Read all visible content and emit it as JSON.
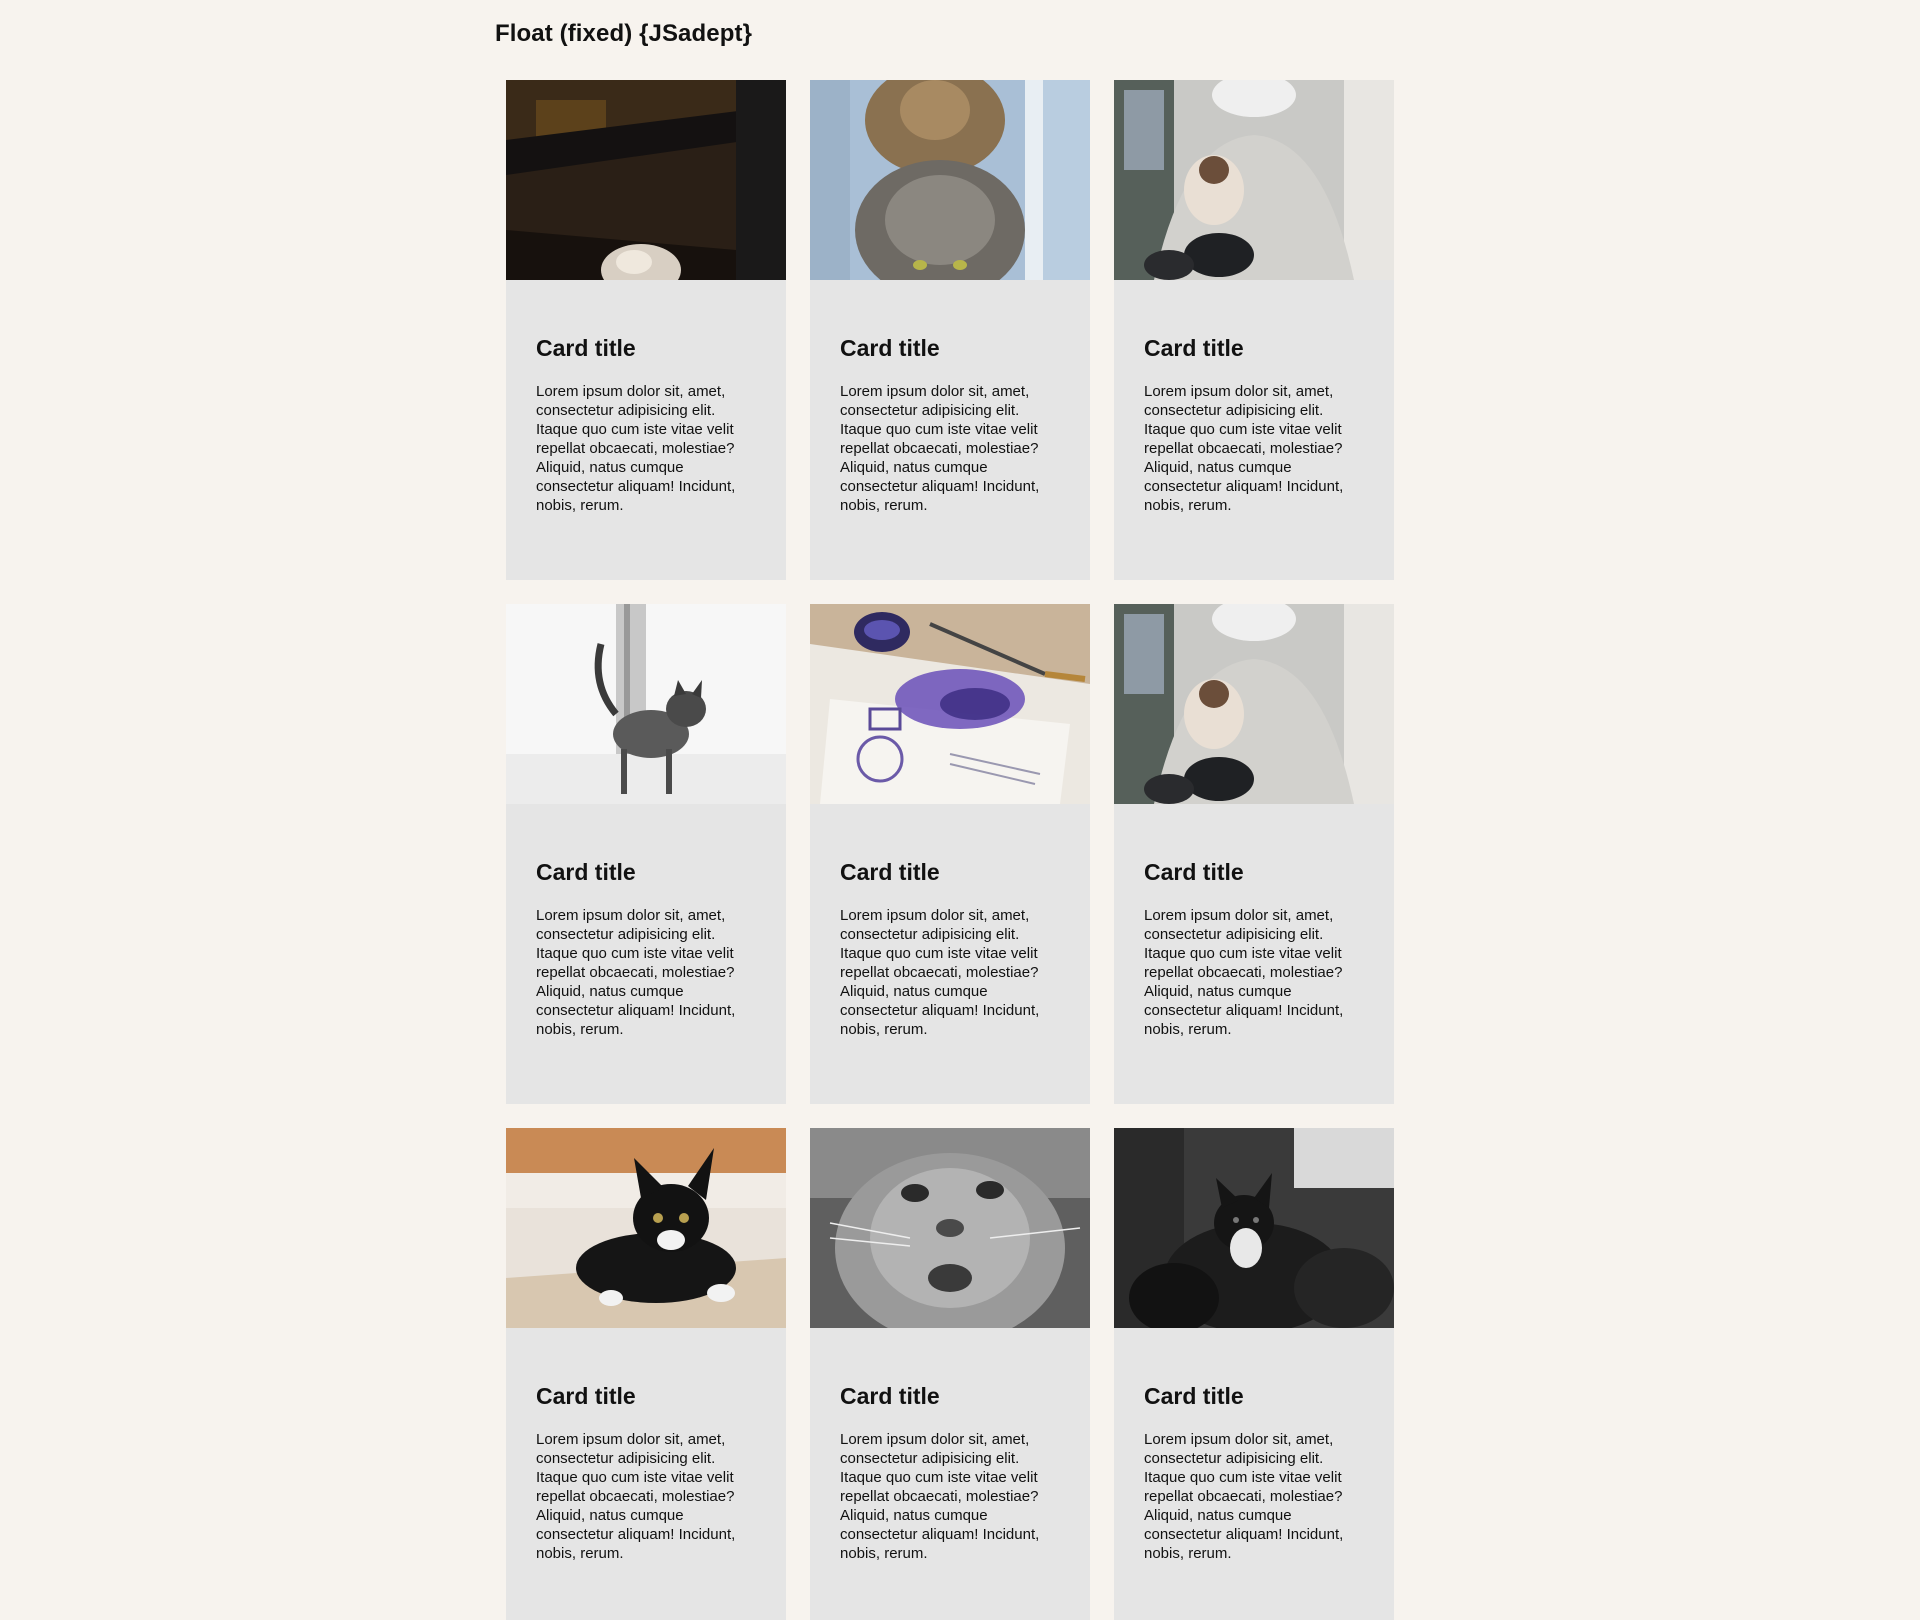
{
  "page": {
    "title": "Float (fixed) {JSadept}"
  },
  "cards": [
    {
      "title": "Card title",
      "text": "Lorem ipsum dolor sit, amet, consectetur adipisicing elit. Itaque quo cum iste vitae velit repellat obcaecati, molestiae? Aliquid, natus cumque consectetur aliquam! Incidunt, nobis, rerum.",
      "image": "cat-under-dark-chair-photo"
    },
    {
      "title": "Card title",
      "text": "Lorem ipsum dolor sit, amet, consectetur adipisicing elit. Itaque quo cum iste vitae velit repellat obcaecati, molestiae? Aliquid, natus cumque consectetur aliquam! Incidunt, nobis, rerum.",
      "image": "two-tabby-cats-photo"
    },
    {
      "title": "Card title",
      "text": "Lorem ipsum dolor sit, amet, consectetur adipisicing elit. Itaque quo cum iste vitae velit repellat obcaecati, molestiae? Aliquid, natus cumque consectetur aliquam! Incidunt, nobis, rerum.",
      "image": "rider-holding-kitten-photo"
    },
    {
      "title": "Card title",
      "text": "Lorem ipsum dolor sit, amet, consectetur adipisicing elit. Itaque quo cum iste vitae velit repellat obcaecati, molestiae? Aliquid, natus cumque consectetur aliquam! Incidunt, nobis, rerum.",
      "image": "tabby-kitten-window-photo"
    },
    {
      "title": "Card title",
      "text": "Lorem ipsum dolor sit, amet, consectetur adipisicing elit. Itaque quo cum iste vitae velit repellat obcaecati, molestiae? Aliquid, natus cumque consectetur aliquam! Incidunt, nobis, rerum.",
      "image": "ink-drawing-palette-photo"
    },
    {
      "title": "Card title",
      "text": "Lorem ipsum dolor sit, amet, consectetur adipisicing elit. Itaque quo cum iste vitae velit repellat obcaecati, molestiae? Aliquid, natus cumque consectetur aliquam! Incidunt, nobis, rerum.",
      "image": "rider-holding-kitten-photo"
    },
    {
      "title": "Card title",
      "text": "Lorem ipsum dolor sit, amet, consectetur adipisicing elit. Itaque quo cum iste vitae velit repellat obcaecati, molestiae? Aliquid, natus cumque consectetur aliquam! Incidunt, nobis, rerum.",
      "image": "black-white-kitten-photo"
    },
    {
      "title": "Card title",
      "text": "Lorem ipsum dolor sit, amet, consectetur adipisicing elit. Itaque quo cum iste vitae velit repellat obcaecati, molestiae? Aliquid, natus cumque consectetur aliquam! Incidunt, nobis, rerum.",
      "image": "grayscale-cat-face-photo"
    },
    {
      "title": "Card title",
      "text": "Lorem ipsum dolor sit, amet, consectetur adipisicing elit. Itaque quo cum iste vitae velit repellat obcaecati, molestiae? Aliquid, natus cumque consectetur aliquam! Incidunt, nobis, rerum.",
      "image": "grayscale-kittens-photo"
    }
  ],
  "colors": {
    "page_background": "#f7f3ee",
    "card_background": "#e5e5e5",
    "text": "#111111"
  }
}
